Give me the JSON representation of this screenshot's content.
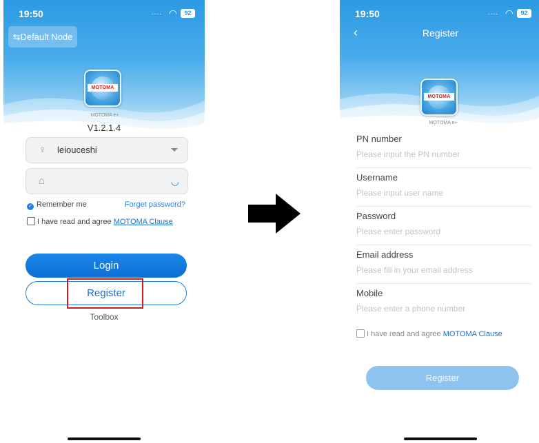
{
  "left_screen": {
    "status": {
      "time": "19:50",
      "signal": "....",
      "battery": "92"
    },
    "node_button": "⇆Default Node",
    "brand_label": "MOTOMA e+",
    "logo_text": "MOTOMA",
    "version": "V1.2.1.4",
    "username_value": "leiouceshi",
    "password_value": "",
    "remember_label": "Remember me",
    "forgot_label": "Forget password?",
    "agree_prefix": "I have read and agree ",
    "agree_link": "MOTOMA Clause",
    "login_label": "Login",
    "register_label": "Register",
    "toolbox_label": "Toolbox"
  },
  "right_screen": {
    "status": {
      "time": "19:50",
      "signal": "....",
      "battery": "92"
    },
    "title": "Register",
    "brand_label": "MOTOMA e+",
    "logo_text": "MOTOMA",
    "fields": [
      {
        "label": "PN number",
        "placeholder": "Please input the PN number"
      },
      {
        "label": "Username",
        "placeholder": "Please input user name"
      },
      {
        "label": "Password",
        "placeholder": "Please enter password"
      },
      {
        "label": "Email address",
        "placeholder": "Please fill in your email address"
      },
      {
        "label": "Mobile",
        "placeholder": "Please enter a phone number"
      }
    ],
    "agree_prefix": "I have read and agree ",
    "agree_link": "MOTOMA Clause",
    "register_label": "Register"
  },
  "colors": {
    "primary": "#1a78dc",
    "highlight": "#d11a1a",
    "disabled_button": "#8ec3ef"
  }
}
